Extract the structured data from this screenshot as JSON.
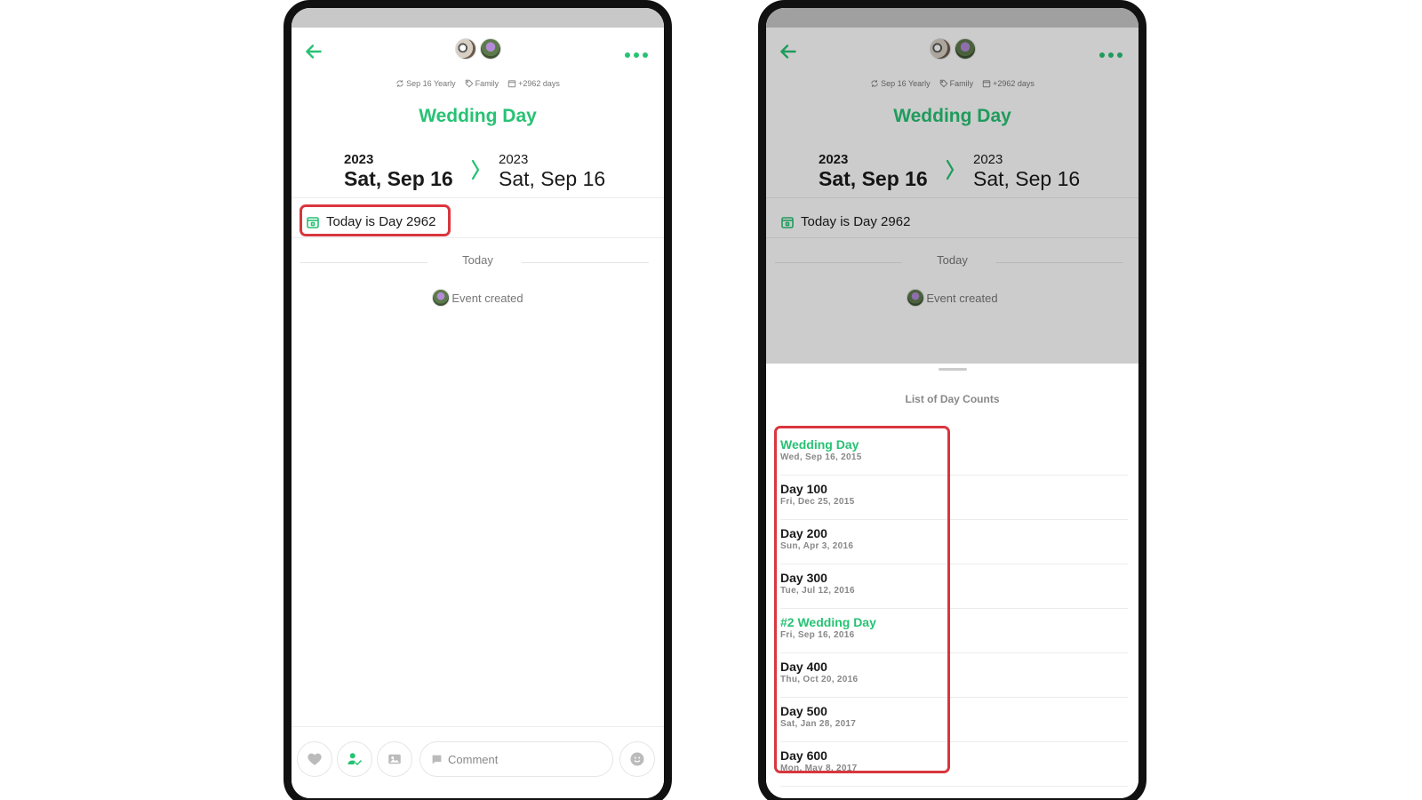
{
  "event": {
    "title": "Wedding Day",
    "repeat": "Sep 16 Yearly",
    "tag": "Family",
    "days_count": "+2962 days",
    "start": {
      "year": "2023",
      "date": "Sat, Sep 16"
    },
    "end": {
      "year": "2023",
      "date": "Sat, Sep 16"
    },
    "today_day": "Today is Day 2962"
  },
  "timeline": {
    "section_label": "Today",
    "activity_text": "Event created"
  },
  "bottom_bar": {
    "comment_placeholder": "Comment"
  },
  "day_counts_sheet": {
    "title": "List of Day Counts",
    "items": [
      {
        "name": "Wedding Day",
        "date": "Wed, Sep 16, 2015",
        "milestone": true
      },
      {
        "name": "Day 100",
        "date": "Fri, Dec 25, 2015",
        "milestone": false
      },
      {
        "name": "Day 200",
        "date": "Sun, Apr 3, 2016",
        "milestone": false
      },
      {
        "name": "Day 300",
        "date": "Tue, Jul 12, 2016",
        "milestone": false
      },
      {
        "name": "#2 Wedding Day",
        "date": "Fri, Sep 16, 2016",
        "milestone": true
      },
      {
        "name": "Day 400",
        "date": "Thu, Oct 20, 2016",
        "milestone": false
      },
      {
        "name": "Day 500",
        "date": "Sat, Jan 28, 2017",
        "milestone": false
      },
      {
        "name": "Day 600",
        "date": "Mon, May 8, 2017",
        "milestone": false
      }
    ]
  },
  "colors": {
    "accent": "#27c274",
    "highlight": "#d9363e",
    "muted": "#777777"
  },
  "icons": [
    "back-arrow-icon",
    "more-icon",
    "repeat-icon",
    "tag-icon",
    "calendar-icon",
    "chevron-right-icon",
    "heart-icon",
    "person-check-icon",
    "image-icon",
    "comment-icon",
    "emoji-icon"
  ]
}
